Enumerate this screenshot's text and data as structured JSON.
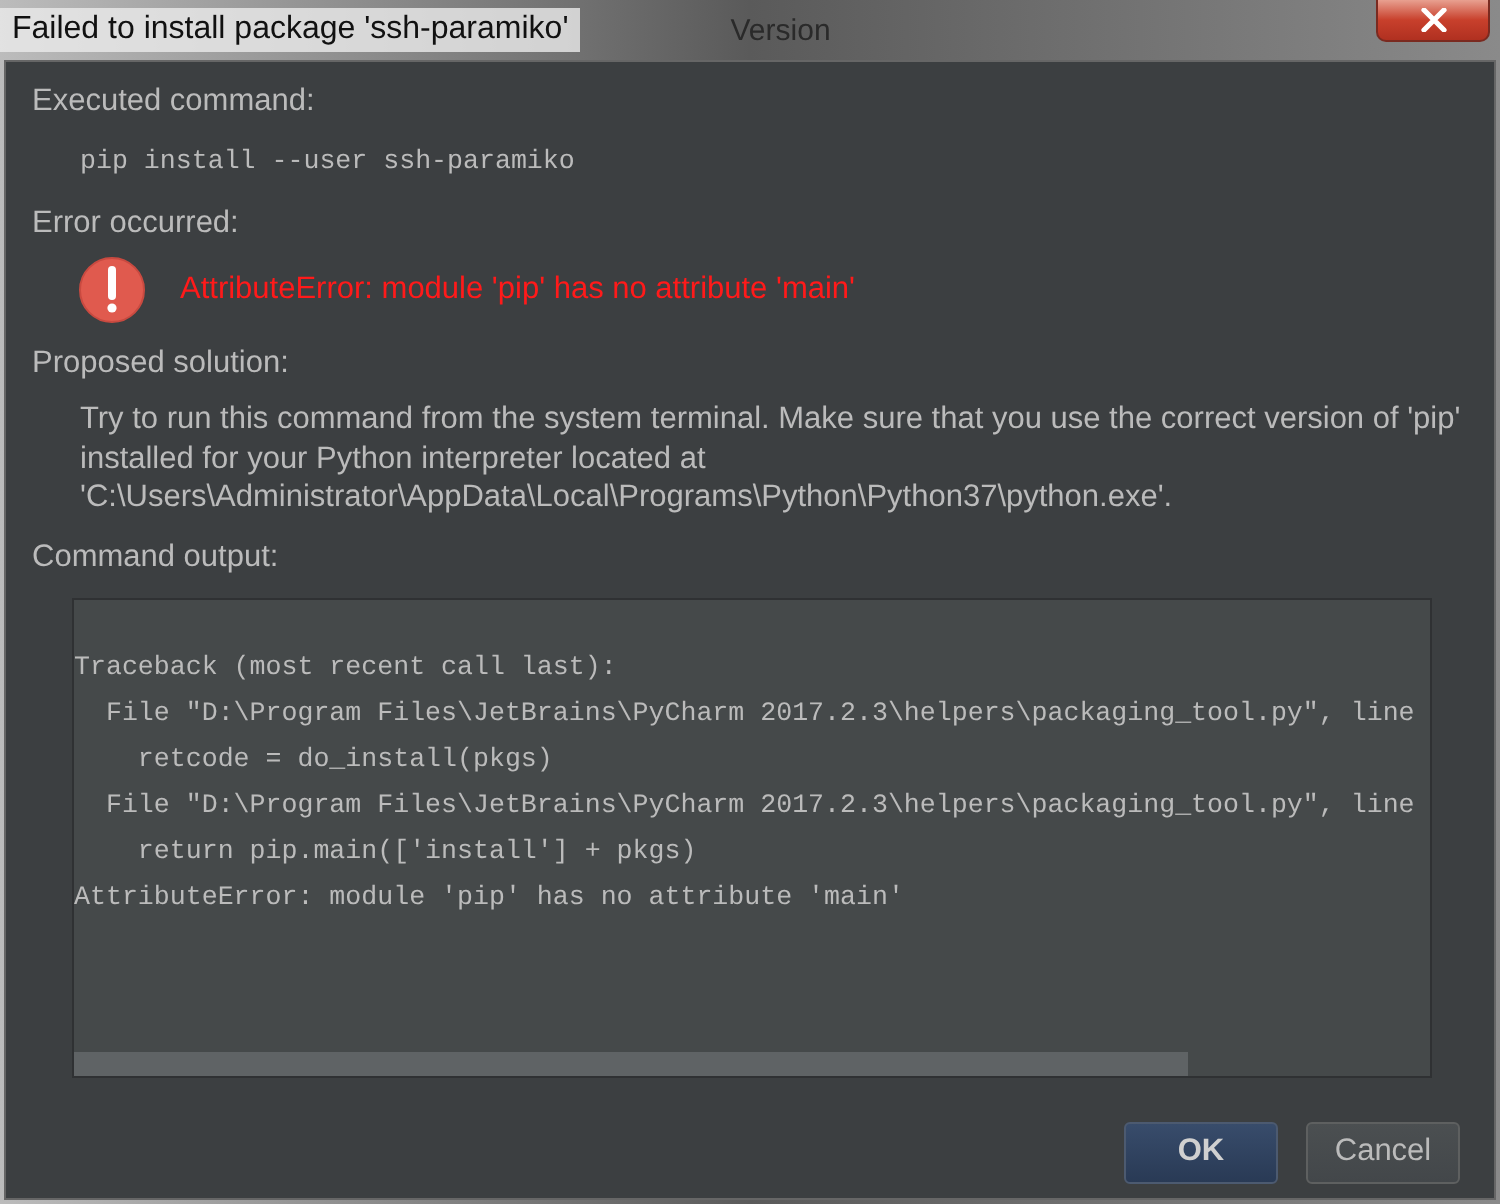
{
  "window": {
    "title": "Failed to install package 'ssh-paramiko'",
    "background_text": "Version"
  },
  "sections": [
    {
      "kind": "command",
      "label": "Executed command:",
      "text": "pip install --user ssh-paramiko"
    },
    {
      "kind": "error",
      "label": "Error occurred:",
      "text": "AttributeError: module 'pip' has no attribute 'main'"
    },
    {
      "kind": "solution",
      "label": "Proposed solution:",
      "text": "Try to run this command from the system terminal. Make sure that you use the correct version of 'pip' installed for your Python interpreter located at 'C:\\Users\\Administrator\\AppData\\Local\\Programs\\Python\\Python37\\python.exe'."
    },
    {
      "kind": "output",
      "label": "Command output:",
      "lines": [
        "Traceback (most recent call last):",
        "  File \"D:\\Program Files\\JetBrains\\PyCharm 2017.2.3\\helpers\\packaging_tool.py\", line",
        "    retcode = do_install(pkgs)",
        "  File \"D:\\Program Files\\JetBrains\\PyCharm 2017.2.3\\helpers\\packaging_tool.py\", line",
        "    return pip.main(['install'] + pkgs)",
        "AttributeError: module 'pip' has no attribute 'main'"
      ]
    }
  ],
  "buttons": [
    {
      "label": "OK",
      "default": true
    },
    {
      "label": "Cancel",
      "default": false
    }
  ]
}
